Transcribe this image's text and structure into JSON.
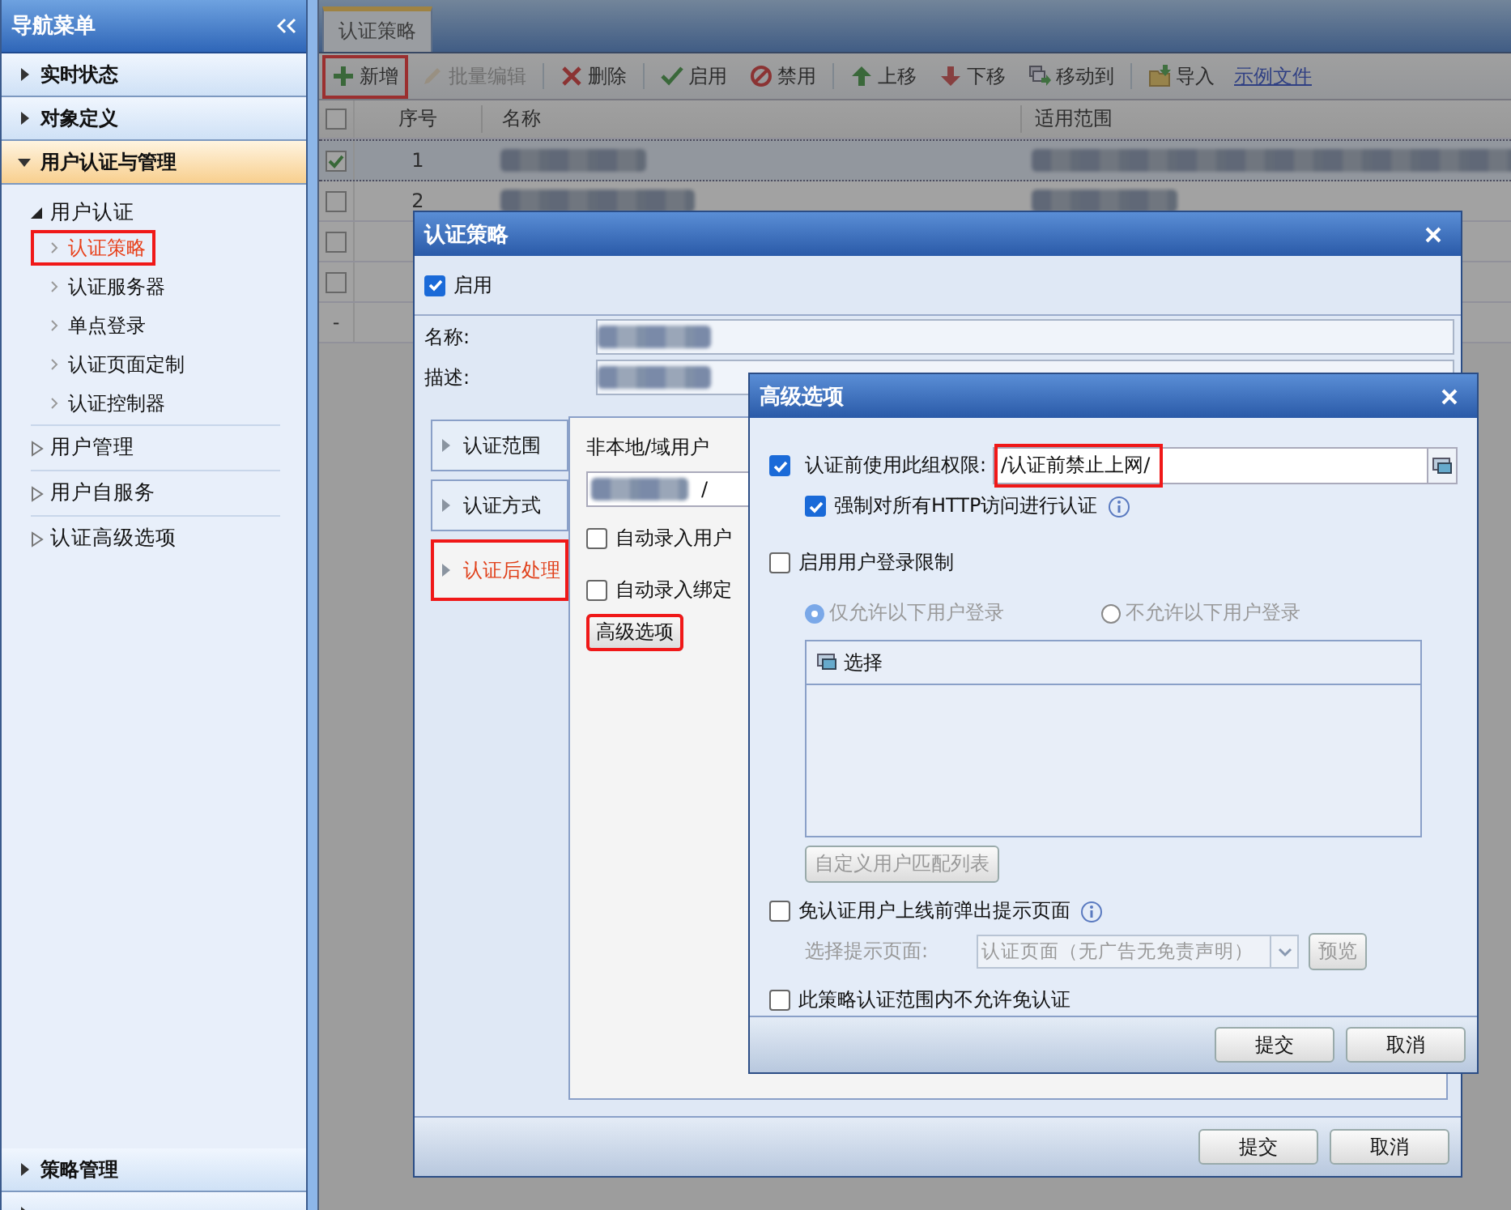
{
  "sidebar": {
    "title": "导航菜单",
    "panels": [
      {
        "label": "实时状态",
        "expanded": false
      },
      {
        "label": "对象定义",
        "expanded": false
      },
      {
        "label": "用户认证与管理",
        "expanded": true,
        "children": [
          {
            "label": "用户认证",
            "expanded": true,
            "children": [
              {
                "label": "认证策略",
                "selected": true,
                "highlighted": true
              },
              {
                "label": "认证服务器",
                "selected": false,
                "highlighted": false
              },
              {
                "label": "单点登录",
                "selected": false,
                "highlighted": false
              },
              {
                "label": "认证页面定制",
                "selected": false,
                "highlighted": false
              },
              {
                "label": "认证控制器",
                "selected": false,
                "highlighted": false
              }
            ]
          },
          {
            "label": "用户管理",
            "expanded": false
          },
          {
            "label": "用户自服务",
            "expanded": false
          },
          {
            "label": "认证高级选项",
            "expanded": false
          }
        ]
      },
      {
        "label": "策略管理",
        "expanded": false
      },
      {
        "expanded": false
      }
    ]
  },
  "tabs": [
    {
      "label": "认证策略",
      "selected": true
    }
  ],
  "toolbar": [
    {
      "kind": "add",
      "label": "新增",
      "disabled": false,
      "highlighted": true,
      "separator_after": false
    },
    {
      "kind": "edit",
      "label": "批量编辑",
      "disabled": true,
      "highlighted": false,
      "separator_after": true
    },
    {
      "kind": "delete",
      "label": "删除",
      "disabled": false,
      "highlighted": false,
      "separator_after": true
    },
    {
      "kind": "enable",
      "label": "启用",
      "disabled": false,
      "highlighted": false,
      "separator_after": false
    },
    {
      "kind": "disable",
      "label": "禁用",
      "disabled": false,
      "highlighted": false,
      "separator_after": true
    },
    {
      "kind": "up",
      "label": "上移",
      "disabled": false,
      "highlighted": false,
      "separator_after": false
    },
    {
      "kind": "down",
      "label": "下移",
      "disabled": false,
      "highlighted": false,
      "separator_after": false
    },
    {
      "kind": "move",
      "label": "移动到",
      "disabled": false,
      "highlighted": false,
      "separator_after": true
    },
    {
      "kind": "import",
      "label": "导入",
      "disabled": false,
      "highlighted": false,
      "separator_after": false
    },
    {
      "kind": "link",
      "label": "示例文件"
    }
  ],
  "grid": {
    "select_all_checked": false,
    "columns": [
      "序号",
      "名称",
      "适用范围"
    ],
    "rows": [
      {
        "kind": "record",
        "index": "1",
        "checked": true,
        "selected": true
      },
      {
        "kind": "record",
        "index": "2",
        "checked": false,
        "selected": false
      },
      {
        "kind": "empty",
        "checked": false
      },
      {
        "kind": "empty",
        "checked": false
      },
      {
        "kind": "new",
        "marker": "-"
      }
    ]
  },
  "policy_dialog": {
    "title": "认证策略",
    "enabled": {
      "label": "启用",
      "checked": true
    },
    "name_label": "名称:",
    "desc_label": "描述:",
    "side_tabs": [
      {
        "label": "认证范围",
        "selected": false,
        "highlighted": false
      },
      {
        "label": "认证方式",
        "selected": false,
        "highlighted": false
      },
      {
        "label": "认证后处理",
        "selected": true,
        "highlighted": true
      }
    ],
    "panel": {
      "heading": "非本地/域用户",
      "field_suffix": "/",
      "checkboxes": [
        {
          "label": "自动录入用户",
          "checked": false
        },
        {
          "label": "自动录入绑定",
          "checked": false
        }
      ],
      "advanced_button": {
        "label": "高级选项",
        "highlighted": true
      }
    },
    "buttons": [
      "提交",
      "取消"
    ]
  },
  "advanced_dialog": {
    "title": "高级选项",
    "group_permission": {
      "label": "认证前使用此组权限:",
      "checked": true,
      "value": "/认证前禁止上网/",
      "highlighted": true
    },
    "force_http": {
      "label": "强制对所有HTTP访问进行认证",
      "checked": true
    },
    "login_limit": {
      "label": "启用用户登录限制",
      "checked": false
    },
    "radios": [
      {
        "label": "仅允许以下用户登录",
        "selected": true
      },
      {
        "label": "不允许以下用户登录",
        "selected": false
      }
    ],
    "list_header": "选择",
    "custom_button": "自定义用户匹配列表",
    "popup": {
      "label": "免认证用户上线前弹出提示页面",
      "checked": false
    },
    "page_label": "选择提示页面:",
    "page_value": "认证页面（无广告无免责声明）",
    "preview_button": "预览",
    "no_exempt": {
      "label": "此策略认证范围内不允许免认证",
      "checked": false
    },
    "buttons": [
      "提交",
      "取消"
    ]
  }
}
